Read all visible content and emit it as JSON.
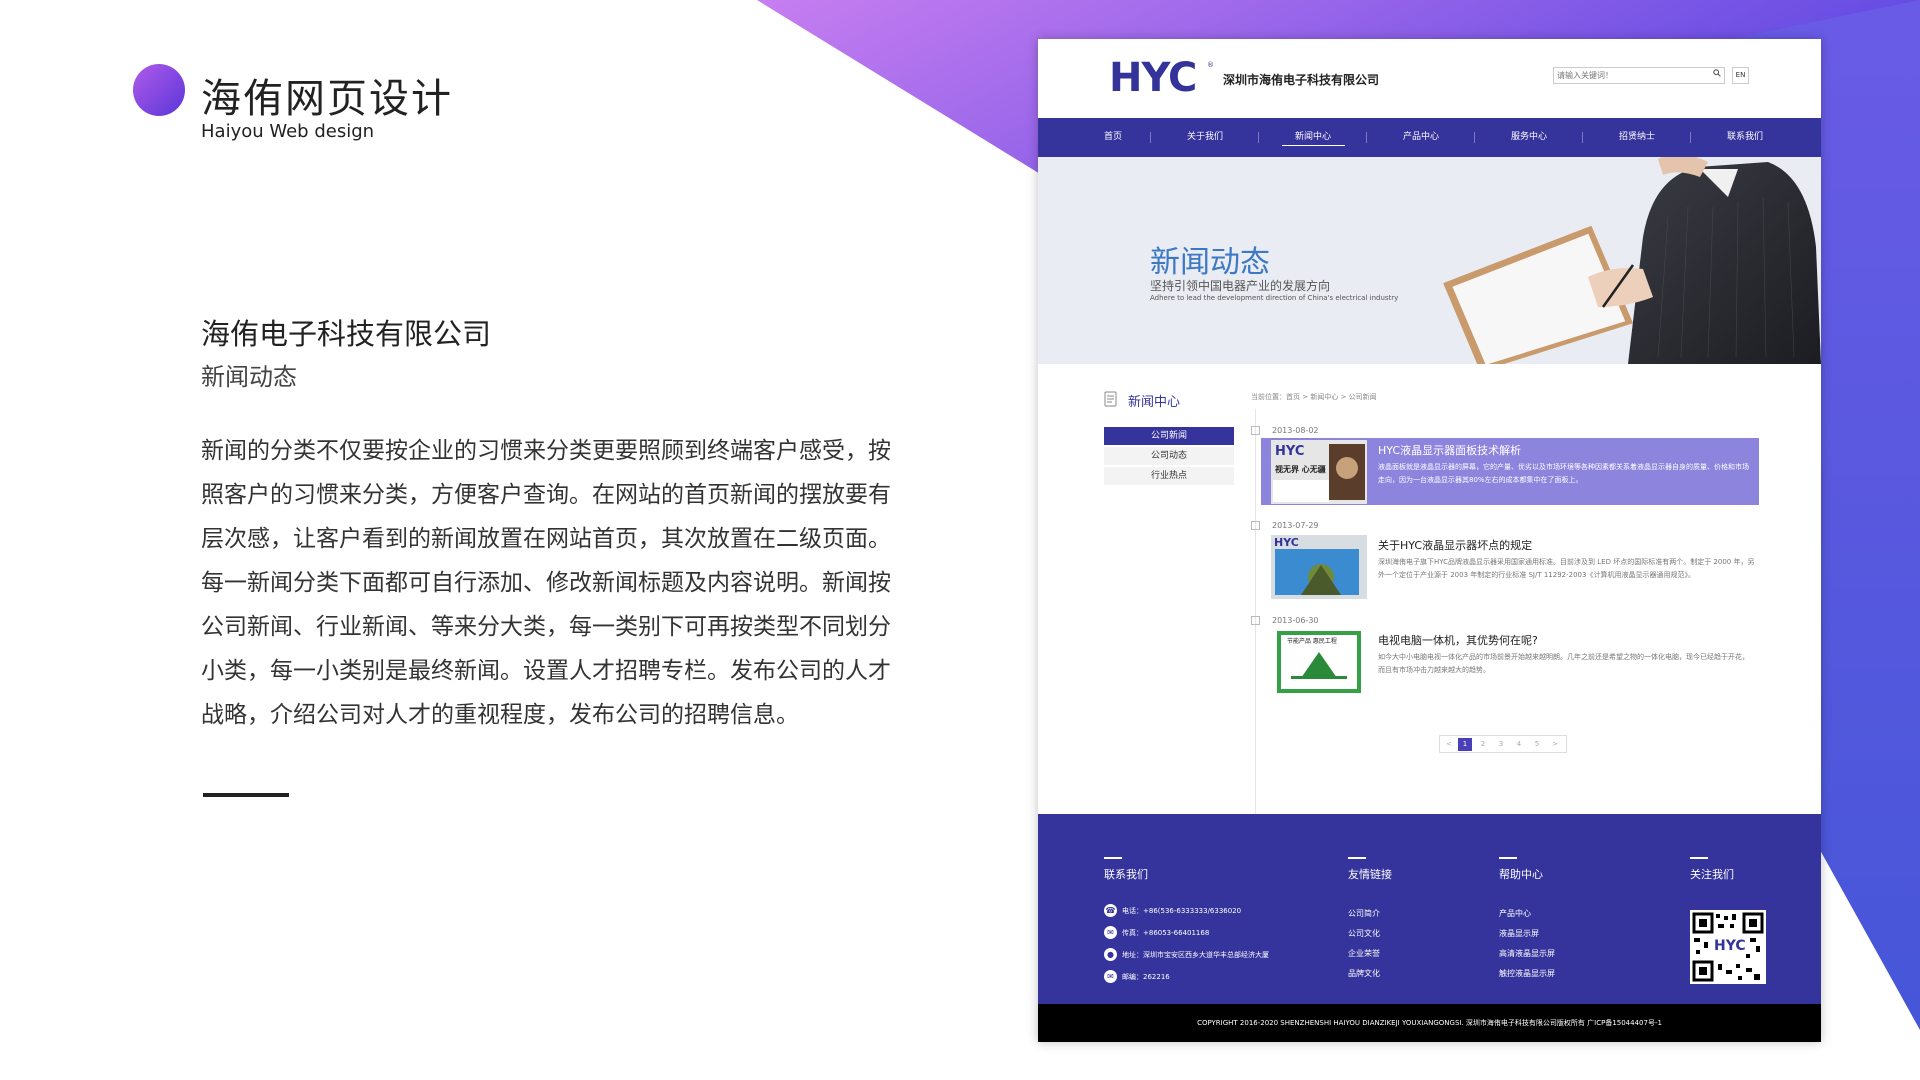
{
  "brand": {
    "title": "海侑网页设计",
    "subtitle": "Haiyou Web design"
  },
  "intro": {
    "company": "海侑电子科技有限公司",
    "page": "新闻动态",
    "description": "新闻的分类不仅要按企业的习惯来分类更要照顾到终端客户感受，按照客户的习惯来分类，方便客户查询。在网站的首页新闻的摆放要有层次感，让客户看到的新闻放置在网站首页，其次放置在二级页面。每一新闻分类下面都可自行添加、修改新闻标题及内容说明。新闻按公司新闻、行业新闻、等来分大类，每一类别下可再按类型不同划分小类，每一小类别是最终新闻。设置人才招聘专栏。发布公司的人才战略，介绍公司对人才的重视程度，发布公司的招聘信息。"
  },
  "colors": {
    "accent": "#35339c",
    "highlight": "#8d85dd",
    "banner_title": "#3c78c4",
    "gradient_start": "#c77ef0",
    "gradient_end": "#5a36d8"
  },
  "site": {
    "logo": "HYC",
    "logo_mark": "®",
    "company": "深圳市海侑电子科技有限公司",
    "search_placeholder": "请输入关键词！",
    "search_icon": "search-icon",
    "lang": "EN",
    "nav": [
      "首页",
      "关于我们",
      "新闻中心",
      "产品中心",
      "服务中心",
      "招贤纳士",
      "联系我们"
    ],
    "nav_active": 2,
    "banner": {
      "title": "新闻动态",
      "subtitle": "坚持引领中国电器产业的发展方向",
      "en": "Adhere to lead the development direction of China's electrical industry"
    },
    "sidebar": {
      "title": "新闻中心",
      "items": [
        "公司新闻",
        "公司动态",
        "行业热点"
      ],
      "active": 0
    },
    "breadcrumb": "当前位置：首页 > 新闻中心 > 公司新闻",
    "news": [
      {
        "date": "2013-08-02",
        "title": "HYC液晶显示器面板技术解析",
        "summary": "液晶面板就是液晶显示器的屏幕，它的产量、优劣以及市场环境等各种因素都关系着液晶显示器自身的质量、价格和市场走向，因为一台液晶显示器其80%左右的成本都集中在了面板上。",
        "thumb_logo": "HYC",
        "thumb_text": "视无界 心无疆",
        "highlighted": true
      },
      {
        "date": "2013-07-29",
        "title": "关于HYC液晶显示器坏点的规定",
        "summary": "深圳海侑电子旗下HYC品牌液晶显示器采用国家通用标准。目前涉及到 LED 坏点的国际标准有两个。制定于 2000 年，另外一个定位于产业源于 2003 年制定的行业标准 SJ/T 11292-2003《计算机用液晶显示器通用规范》。",
        "thumb_logo": "HYC",
        "highlighted": false
      },
      {
        "date": "2013-06-30",
        "title": "电视电脑一体机，其优势何在呢?",
        "summary": "如今大中小电脑电视一体化产品的市场前景开始越来越明朗。几年之前还是希望之物的一体化电脑，现今已经趋于开花，而且有市场冲击力越来越大的趋势。",
        "thumb_text": "节能产品 惠民工程",
        "highlighted": false
      }
    ],
    "pager": {
      "prev": "<",
      "pages": [
        "1",
        "2",
        "3",
        "4",
        "5"
      ],
      "next": ">",
      "active": 0
    },
    "footer": {
      "contact": {
        "title": "联系我们",
        "items": [
          {
            "icon": "phone-icon",
            "text": "电话：+86(536-6333333/6336020"
          },
          {
            "icon": "fax-icon",
            "text": "传真：+86053-66401168"
          },
          {
            "icon": "location-icon",
            "text": "地址：深圳市宝安区西乡大道华丰总部经济大厦"
          },
          {
            "icon": "mail-icon",
            "text": "邮编：262216"
          }
        ]
      },
      "links": {
        "title": "友情链接",
        "items": [
          "公司简介",
          "公司文化",
          "企业荣誉",
          "品牌文化"
        ]
      },
      "help": {
        "title": "帮助中心",
        "items": [
          "产品中心",
          "液晶显示屏",
          "高清液晶显示屏",
          "触控液晶显示屏"
        ]
      },
      "follow": {
        "title": "关注我们",
        "qr_logo": "HYC"
      }
    },
    "copyright": "COPYRIGHT 2016-2020 SHENZHENSHI HAIYOU DIANZIKEJI YOUXIANGONGSI. 深圳市海侑电子科技有限公司版权所有 广ICP备15044407号-1"
  }
}
